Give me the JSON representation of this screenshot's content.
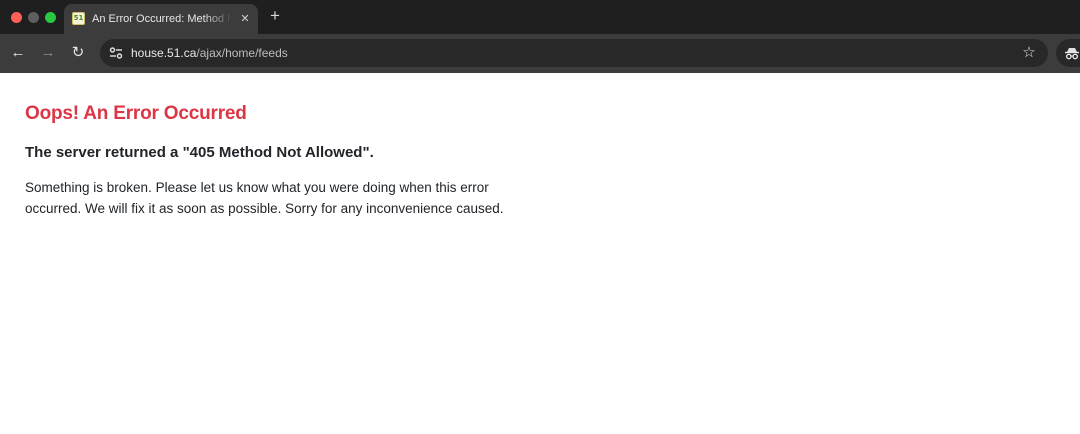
{
  "browser": {
    "tab": {
      "favicon_text": "51",
      "title": "An Error Occurred: Method Not Allowed",
      "close_glyph": "✕"
    },
    "new_tab_glyph": "+",
    "nav": {
      "back_glyph": "←",
      "forward_glyph": "→",
      "reload_glyph": "↻"
    },
    "address": {
      "host": "house.51.ca",
      "path": "/ajax/home/feeds"
    },
    "bookmark_glyph": "☆",
    "colors": {
      "tabbar": "#1f1f1f",
      "toolbar": "#3c3c3c",
      "omnibox": "#282828"
    }
  },
  "page": {
    "ghost_text": "",
    "title": "Oops! An Error Occurred",
    "subtitle": "The server returned a \"405 Method Not Allowed\".",
    "description": "Something is broken. Please let us know what you were doing when this error occurred. We will fix it as soon as possible. Sorry for any inconvenience caused.",
    "colors": {
      "title": "#dc3545",
      "text": "#212529"
    }
  }
}
